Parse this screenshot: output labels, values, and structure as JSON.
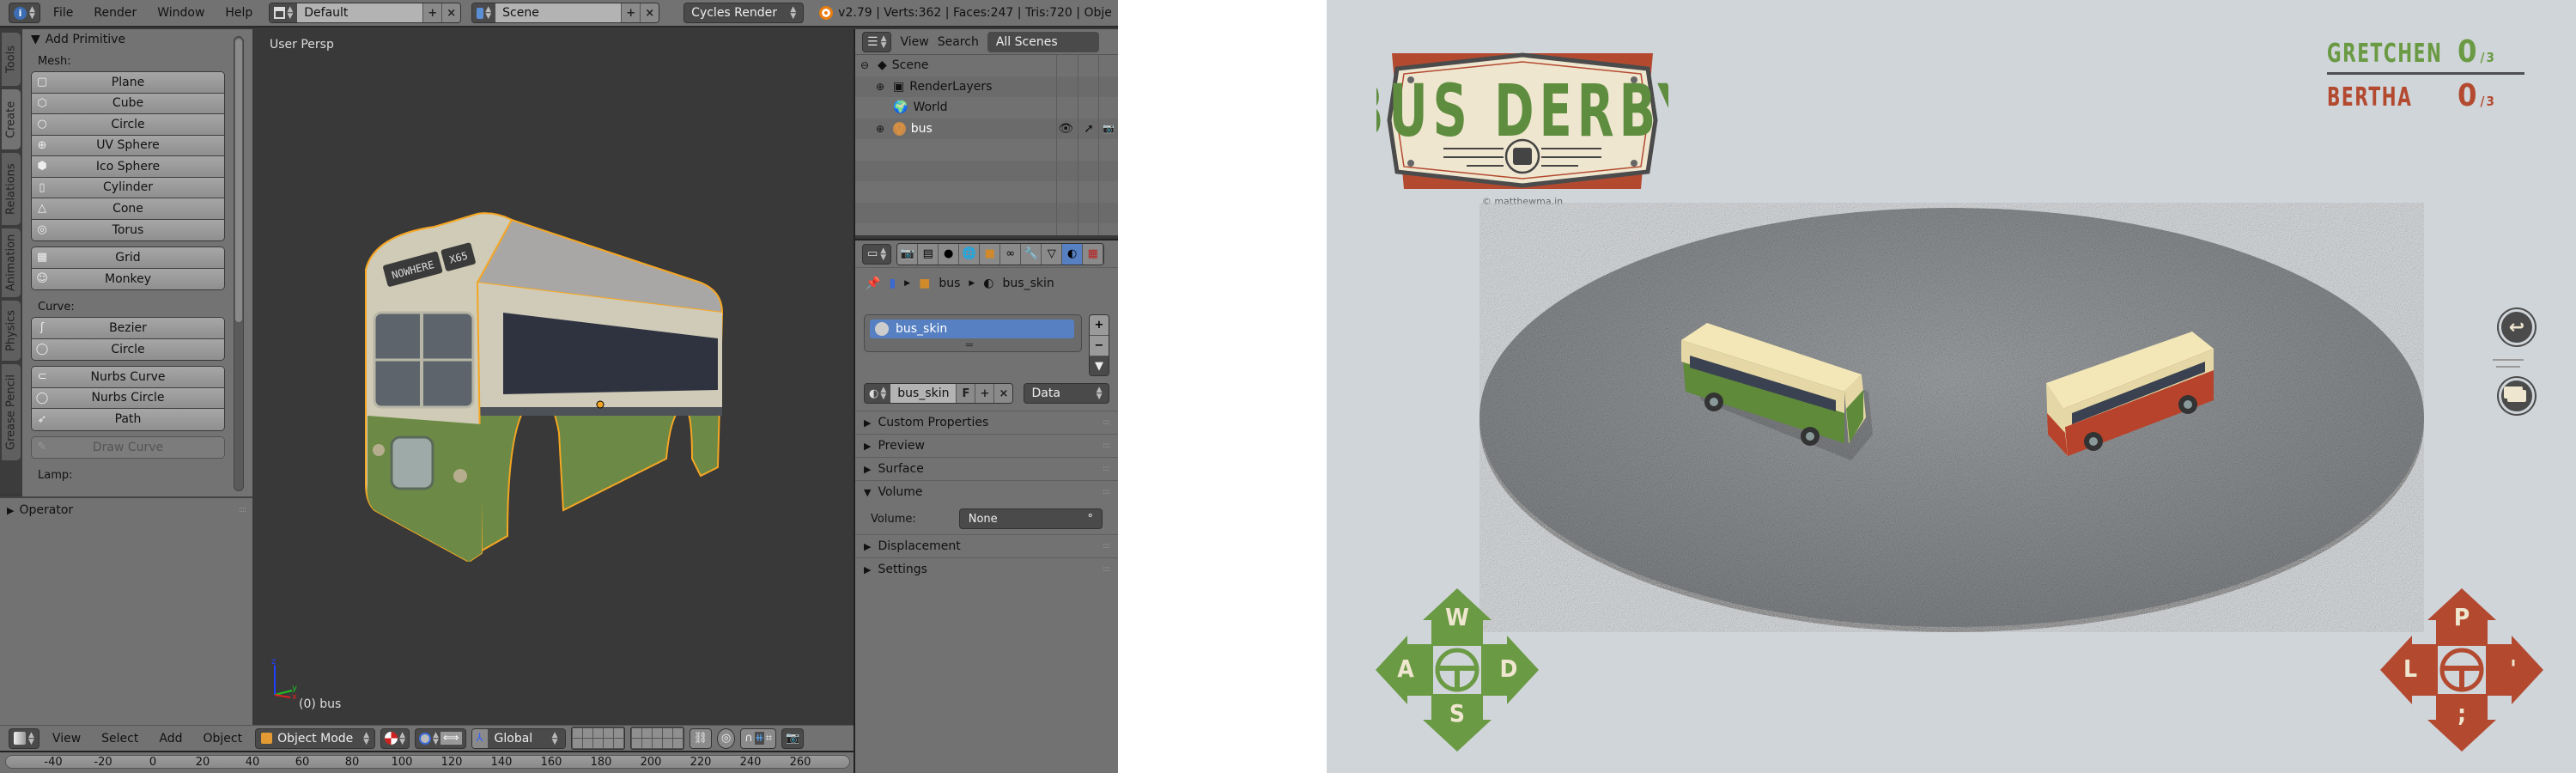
{
  "blender": {
    "topbar": {
      "menus": [
        "File",
        "Render",
        "Window",
        "Help"
      ],
      "screen_layout": "Default",
      "scene": "Scene",
      "renderer": "Cycles Render",
      "stats": "v2.79 | Verts:362 | Faces:247 | Tris:720 | Obje"
    },
    "toolshelf": {
      "tabs": [
        "Tools",
        "Create",
        "Relations",
        "Animation",
        "Physics",
        "Grease Pencil"
      ],
      "active_tab": "Create",
      "panel_title": "Add Primitive",
      "mesh_label": "Mesh:",
      "mesh_items": [
        {
          "label": "Plane",
          "icon": "plane-icon"
        },
        {
          "label": "Cube",
          "icon": "cube-icon"
        },
        {
          "label": "Circle",
          "icon": "circle-icon"
        },
        {
          "label": "UV Sphere",
          "icon": "uv-sphere-icon"
        },
        {
          "label": "Ico Sphere",
          "icon": "ico-sphere-icon"
        },
        {
          "label": "Cylinder",
          "icon": "cylinder-icon"
        },
        {
          "label": "Cone",
          "icon": "cone-icon"
        },
        {
          "label": "Torus",
          "icon": "torus-icon"
        }
      ],
      "mesh_items2": [
        {
          "label": "Grid",
          "icon": "grid-icon"
        },
        {
          "label": "Monkey",
          "icon": "monkey-icon"
        }
      ],
      "curve_label": "Curve:",
      "curve_items": [
        {
          "label": "Bezier",
          "icon": "bezier-icon"
        },
        {
          "label": "Circle",
          "icon": "curve-circle-icon"
        }
      ],
      "curve_items2": [
        {
          "label": "Nurbs Curve",
          "icon": "nurbs-curve-icon"
        },
        {
          "label": "Nurbs Circle",
          "icon": "nurbs-circle-icon"
        },
        {
          "label": "Path",
          "icon": "path-icon"
        }
      ],
      "draw_curve": "Draw Curve",
      "lamp_label": "Lamp:",
      "operator_label": "Operator"
    },
    "viewport": {
      "view_name": "User Persp",
      "object_info": "(0) bus",
      "sign_left": "NOWHERE",
      "sign_right": "X65"
    },
    "view3d_header": {
      "menus": [
        "View",
        "Select",
        "Add",
        "Object"
      ],
      "mode": "Object Mode",
      "orientation": "Global"
    },
    "timeline": {
      "ticks": [
        "-40",
        "-20",
        "0",
        "20",
        "40",
        "60",
        "80",
        "100",
        "120",
        "140",
        "160",
        "180",
        "200",
        "220",
        "240",
        "260"
      ]
    },
    "outliner": {
      "menus": [
        "View",
        "Search"
      ],
      "filter": "All Scenes",
      "items": [
        {
          "label": "Scene",
          "indent": 0
        },
        {
          "label": "RenderLayers",
          "indent": 1
        },
        {
          "label": "World",
          "indent": 1
        },
        {
          "label": "bus",
          "indent": 1
        }
      ]
    },
    "properties": {
      "breadcrumb": [
        "bus",
        "bus_skin"
      ],
      "slot": "bus_skin",
      "material_name": "bus_skin",
      "fake_user": "F",
      "link": "Data",
      "sections": [
        {
          "label": "Custom Properties",
          "open": false
        },
        {
          "label": "Preview",
          "open": false
        },
        {
          "label": "Surface",
          "open": false
        },
        {
          "label": "Volume",
          "open": true
        },
        {
          "label": "Displacement",
          "open": false
        },
        {
          "label": "Settings",
          "open": false
        }
      ],
      "volume_label": "Volume:",
      "volume_value": "None"
    }
  },
  "game": {
    "title": "BUS DERBY",
    "credit": "© matthewma.in",
    "players": [
      {
        "name": "GRETCHEN",
        "score": "0",
        "max": "/3",
        "color": "#6a9a43"
      },
      {
        "name": "BERTHA",
        "score": "0",
        "max": "/3",
        "color": "#b34a30"
      }
    ],
    "controls_p1": {
      "up": "W",
      "left": "A",
      "right": "D",
      "down": "S",
      "color": "#6a9a43"
    },
    "controls_p2": {
      "up": "P",
      "left": "L",
      "right": "'",
      "down": ";",
      "color": "#b34a30"
    },
    "colors": {
      "bg": "#d0d5da",
      "cream": "#efe6cf",
      "dark": "#4b4b4b"
    }
  }
}
